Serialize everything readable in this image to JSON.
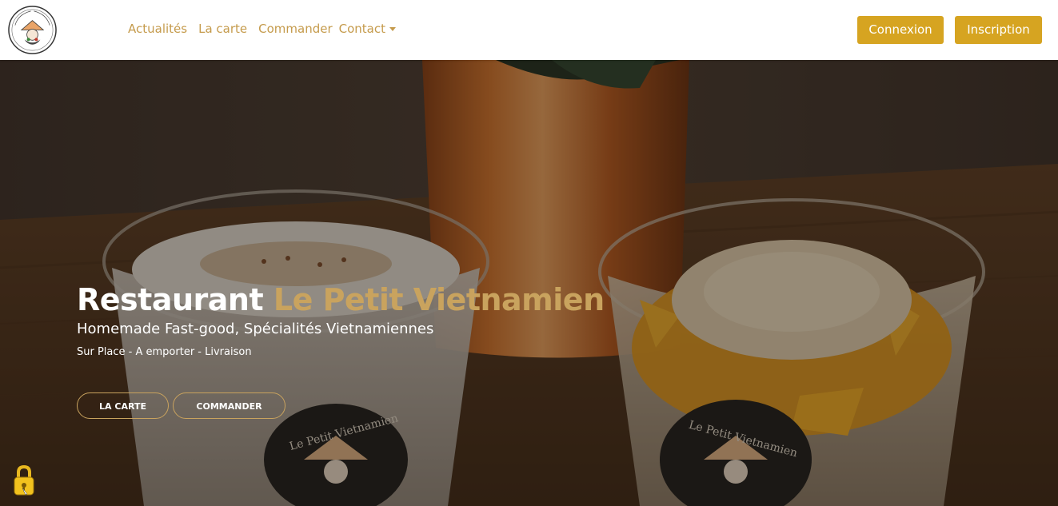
{
  "header": {
    "logo_icon": "le-petit-vietnamien-logo",
    "nav": [
      {
        "label": "Actualités"
      },
      {
        "label": "La carte"
      },
      {
        "label": "Commander"
      },
      {
        "label": "Contact",
        "has_dropdown": true
      }
    ],
    "login_label": "Connexion",
    "signup_label": "Inscription"
  },
  "hero": {
    "title_prefix": "Restaurant",
    "title_accent": "Le Petit Vietnamien",
    "subtitle": "Homemade Fast-good, Spécialités Vietnamiennes",
    "tagline": "Sur Place - A emporter - Livraison",
    "btn_carte": "LA CARTE",
    "btn_commander": "COMMANDER",
    "cup_logo_text": "Le Petit Vietnamien",
    "accessibility_icon": "lock-icon"
  },
  "colors": {
    "accent_gold": "#c9a35e",
    "button_gold": "#d6a421",
    "nav_text": "#c59b4c"
  }
}
